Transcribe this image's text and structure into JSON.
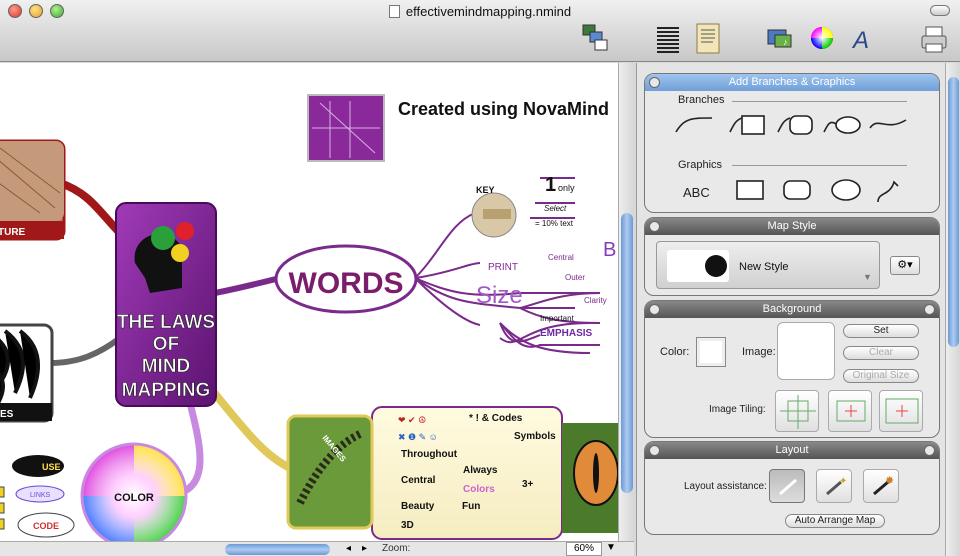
{
  "window": {
    "title": "effectivemindmapping.nmind"
  },
  "toolbar": {
    "icons": [
      "outline-icon",
      "lines-icon",
      "notes-icon",
      "media-icon",
      "colors-icon",
      "fonts-icon",
      "print-icon"
    ]
  },
  "map": {
    "banner": "Created using NovaMind",
    "central": [
      "THE LAWS",
      "OF",
      "MIND",
      "MAPPING"
    ],
    "texture_label": "TURE",
    "zebra_label": "ES",
    "words": "WORDS",
    "key_label": "KEY",
    "one": "1",
    "only": "only",
    "select": "Select",
    "ten_percent": "= 10% text",
    "b_letter": "B",
    "print": "PRINT",
    "central_lbl": "Central",
    "outer": "Outer",
    "clarity": "Clarity",
    "size": "Size",
    "important": "Important",
    "emphasis": "EMPHASIS",
    "images": "IMAGES",
    "codes": "* ! &  Codes",
    "symbols": "Symbols",
    "throughout": "Throughout",
    "always": "Always",
    "central2": "Central",
    "colors": "Colors",
    "three_plus": "3+",
    "beauty": "Beauty",
    "fun": "Fun",
    "three_d": "3D",
    "color": "COLOR",
    "use": "USE",
    "links": "LINKS",
    "code": "CODE"
  },
  "statusbar": {
    "zoom_label": "Zoom:",
    "zoom_value": "60%"
  },
  "panels": {
    "branches": {
      "title": "Add Branches & Graphics",
      "branches_label": "Branches",
      "graphics_label": "Graphics"
    },
    "mapstyle": {
      "title": "Map Style",
      "style_name": "New Style"
    },
    "background": {
      "title": "Background",
      "color_label": "Color:",
      "image_label": "Image:",
      "set": "Set",
      "clear": "Clear",
      "original_size": "Original Size",
      "tiling_label": "Image Tiling:"
    },
    "layout": {
      "title": "Layout",
      "assist_label": "Layout assistance:",
      "auto_arrange": "Auto Arrange Map"
    }
  },
  "colors": {
    "central_node": "#7a1d8c",
    "branch_purple": "#7a2a8a",
    "panel_header": "#666666",
    "accent_blue": "#6f9fd8"
  }
}
